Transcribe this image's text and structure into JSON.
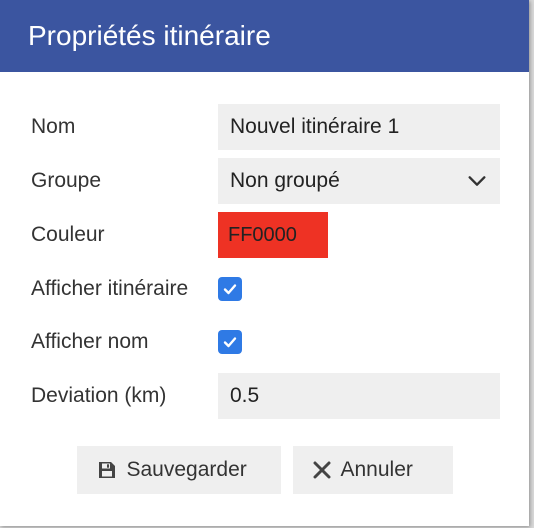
{
  "dialog": {
    "title": "Propriétés itinéraire"
  },
  "form": {
    "name_label": "Nom",
    "name_value": "Nouvel itinéraire 1",
    "group_label": "Groupe",
    "group_value": "Non groupé",
    "color_label": "Couleur",
    "color_value": "FF0000",
    "show_route_label": "Afficher itinéraire",
    "show_route_checked": true,
    "show_name_label": "Afficher nom",
    "show_name_checked": true,
    "deviation_label": "Deviation (km)",
    "deviation_value": "0.5"
  },
  "actions": {
    "save_label": "Sauvegarder",
    "cancel_label": "Annuler"
  },
  "colors": {
    "titlebar": "#3b55a0",
    "color_swatch": "#ee3224",
    "checkbox": "#2f7ae5"
  },
  "icons": {
    "save": "floppy-disk-icon",
    "cancel": "close-icon",
    "select": "chevron-down-icon",
    "check": "checkmark-icon"
  }
}
